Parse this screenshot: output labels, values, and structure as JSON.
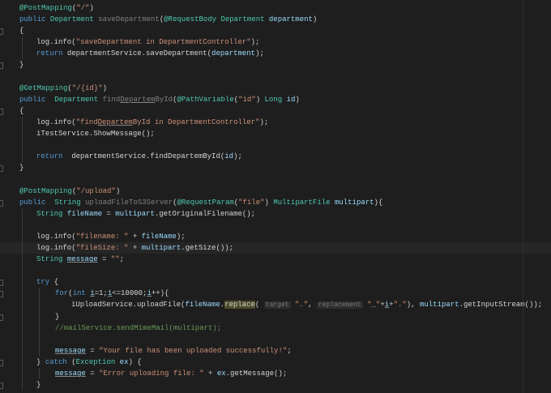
{
  "colors": {
    "background": "#1e1e1e",
    "keyword": "#569cd6",
    "type": "#4ec9b0",
    "string": "#ce9178",
    "comment": "#6a9955"
  },
  "lines": [
    {
      "indent": 0,
      "tokens": [
        [
          "@PostMapping",
          "an"
        ],
        [
          "(",
          "id"
        ],
        [
          "\"/\"",
          "str"
        ],
        [
          ")",
          "id"
        ]
      ]
    },
    {
      "indent": 0,
      "gutter": false,
      "tokens": [
        [
          "public ",
          "kw"
        ],
        [
          "Department ",
          "ty"
        ],
        [
          "saveDepartment",
          "un"
        ],
        [
          "(",
          "id"
        ],
        [
          "@RequestBody ",
          "an"
        ],
        [
          "Department ",
          "ty"
        ],
        [
          "department",
          "var"
        ],
        [
          ")",
          "id"
        ]
      ]
    },
    {
      "indent": 0,
      "gutter": true,
      "tokens": [
        [
          "{",
          "id"
        ]
      ]
    },
    {
      "indent": 1,
      "tokens": [
        [
          "log.info(",
          "id"
        ],
        [
          "\"saveDepartment in DepartmentController\"",
          "str"
        ],
        [
          ");",
          "id"
        ]
      ]
    },
    {
      "indent": 1,
      "tokens": [
        [
          "return ",
          "kw"
        ],
        [
          "departmentService.saveDepartment(",
          "id"
        ],
        [
          "department",
          "var"
        ],
        [
          ");",
          "id"
        ]
      ]
    },
    {
      "indent": 0,
      "gutter": true,
      "tokens": [
        [
          "}",
          "id"
        ]
      ]
    },
    {
      "indent": 0,
      "tokens": []
    },
    {
      "indent": 0,
      "tokens": [
        [
          "@GetMapping",
          "an"
        ],
        [
          "(",
          "id"
        ],
        [
          "\"/{id}\"",
          "str"
        ],
        [
          ")",
          "id"
        ]
      ]
    },
    {
      "indent": 0,
      "tokens": [
        [
          "public  ",
          "kw"
        ],
        [
          "Department ",
          "ty"
        ],
        [
          "find",
          "un"
        ],
        [
          "Departem",
          "un ul"
        ],
        [
          "ById",
          "un"
        ],
        [
          "(",
          "id"
        ],
        [
          "@PathVariable",
          "an"
        ],
        [
          "(",
          "id"
        ],
        [
          "\"id\"",
          "str"
        ],
        [
          ") ",
          "id"
        ],
        [
          "Long ",
          "ty"
        ],
        [
          "id",
          "var"
        ],
        [
          ")",
          "id"
        ]
      ]
    },
    {
      "indent": 0,
      "gutter": true,
      "tokens": [
        [
          "{",
          "id"
        ]
      ]
    },
    {
      "indent": 1,
      "tokens": [
        [
          "log.info(",
          "id"
        ],
        [
          "\"find",
          "str"
        ],
        [
          "Departem",
          "str ul"
        ],
        [
          "ById in DepartmentController\"",
          "str"
        ],
        [
          ");",
          "id"
        ]
      ]
    },
    {
      "indent": 1,
      "tokens": [
        [
          "iTestService.ShowMessage();",
          "id"
        ]
      ]
    },
    {
      "indent": 1,
      "tokens": []
    },
    {
      "indent": 1,
      "tokens": [
        [
          "return  ",
          "kw"
        ],
        [
          "departmentService.findDepartemById(",
          "id"
        ],
        [
          "id",
          "var"
        ],
        [
          ");",
          "id"
        ]
      ]
    },
    {
      "indent": 0,
      "gutter": true,
      "tokens": [
        [
          "}",
          "id"
        ]
      ]
    },
    {
      "indent": 0,
      "tokens": []
    },
    {
      "indent": 0,
      "tokens": [
        [
          "@PostMapping",
          "an"
        ],
        [
          "(",
          "id"
        ],
        [
          "\"/upload\"",
          "str"
        ],
        [
          ")",
          "id"
        ]
      ]
    },
    {
      "indent": 0,
      "gutter": true,
      "tokens": [
        [
          "public  ",
          "kw"
        ],
        [
          "String ",
          "ty"
        ],
        [
          "uploadFileToS3Server",
          "un"
        ],
        [
          "(",
          "id"
        ],
        [
          "@RequestParam",
          "an"
        ],
        [
          "(",
          "id"
        ],
        [
          "\"file\"",
          "str"
        ],
        [
          ") ",
          "id"
        ],
        [
          "MultipartFile ",
          "ty"
        ],
        [
          "multipart",
          "var"
        ],
        [
          "){",
          "id"
        ]
      ]
    },
    {
      "indent": 1,
      "tokens": [
        [
          "String ",
          "ty"
        ],
        [
          "fileName",
          "var"
        ],
        [
          " = ",
          "id"
        ],
        [
          "multipart",
          "var"
        ],
        [
          ".getOriginalFilename();",
          "id"
        ]
      ]
    },
    {
      "indent": 1,
      "tokens": []
    },
    {
      "indent": 1,
      "tokens": [
        [
          "log.info(",
          "id"
        ],
        [
          "\"filename: \"",
          "str"
        ],
        [
          " + ",
          "id"
        ],
        [
          "fileName",
          "var"
        ],
        [
          ");",
          "id"
        ]
      ]
    },
    {
      "indent": 1,
      "highlight": true,
      "tokens": [
        [
          "log.info(",
          "id"
        ],
        [
          "\"fileSize: \"",
          "str"
        ],
        [
          " + ",
          "id"
        ],
        [
          "multipart",
          "var"
        ],
        [
          ".getSize());",
          "id"
        ]
      ]
    },
    {
      "indent": 1,
      "tokens": [
        [
          "String ",
          "ty"
        ],
        [
          "message",
          "var ul"
        ],
        [
          " = ",
          "id"
        ],
        [
          "\"\"",
          "str"
        ],
        [
          ";",
          "id"
        ]
      ]
    },
    {
      "indent": 1,
      "tokens": []
    },
    {
      "indent": 1,
      "gutter": true,
      "tokens": [
        [
          "try ",
          "kw"
        ],
        [
          "{",
          "id"
        ]
      ]
    },
    {
      "indent": 2,
      "gutter": true,
      "tokens": [
        [
          "for",
          "kw"
        ],
        [
          "(",
          "id"
        ],
        [
          "int ",
          "kw"
        ],
        [
          "i",
          "var ul"
        ],
        [
          "=1;",
          "id"
        ],
        [
          "i",
          "var ul"
        ],
        [
          "<=10000;",
          "id"
        ],
        [
          "i",
          "var ul"
        ],
        [
          "++){",
          "id"
        ]
      ]
    },
    {
      "indent": 3,
      "tokens": [
        [
          "iUploadService.uploadFile(",
          "id"
        ],
        [
          "fileName",
          "var"
        ],
        [
          ".",
          "id"
        ],
        [
          "replace",
          "id rep"
        ],
        [
          "( ",
          "id"
        ],
        [
          "target",
          "hint"
        ],
        [
          " \".\"",
          "str"
        ],
        [
          ", ",
          "id"
        ],
        [
          "replacement",
          "hint"
        ],
        [
          " \"_\"",
          "str"
        ],
        [
          "+",
          "id"
        ],
        [
          "i",
          "var ul"
        ],
        [
          "+",
          "id"
        ],
        [
          "\".\"",
          "str"
        ],
        [
          "), ",
          "id"
        ],
        [
          "multipart",
          "var"
        ],
        [
          ".getInputStream());",
          "id"
        ]
      ]
    },
    {
      "indent": 2,
      "gutter": true,
      "tokens": [
        [
          "}",
          "id"
        ]
      ]
    },
    {
      "indent": 2,
      "tokens": [
        [
          "//mailService.sendMimeMail(multipart);",
          "cm"
        ]
      ]
    },
    {
      "indent": 2,
      "tokens": []
    },
    {
      "indent": 2,
      "tokens": [
        [
          "message",
          "var ul"
        ],
        [
          " = ",
          "id"
        ],
        [
          "\"Your file has been uploaded successfully!\"",
          "str"
        ],
        [
          ";",
          "id"
        ]
      ]
    },
    {
      "indent": 1,
      "gutter": true,
      "tokens": [
        [
          "} ",
          "id"
        ],
        [
          "catch ",
          "kw"
        ],
        [
          "(",
          "id"
        ],
        [
          "Exception ",
          "ty"
        ],
        [
          "ex",
          "var"
        ],
        [
          ") {",
          "id"
        ]
      ]
    },
    {
      "indent": 2,
      "tokens": [
        [
          "message",
          "var ul"
        ],
        [
          " = ",
          "id"
        ],
        [
          "\"Error uploading file: \"",
          "str"
        ],
        [
          " + ",
          "id"
        ],
        [
          "ex",
          "var"
        ],
        [
          ".getMessage();",
          "id"
        ]
      ]
    },
    {
      "indent": 1,
      "gutter": true,
      "tokens": [
        [
          "}",
          "id"
        ]
      ]
    }
  ]
}
